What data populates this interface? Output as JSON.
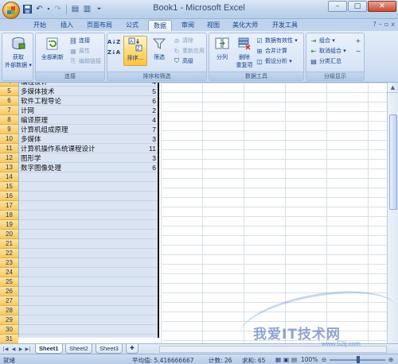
{
  "window": {
    "title": "Book1 - Microsoft Excel",
    "min": "–",
    "max": "□",
    "close": "✕"
  },
  "tabs": [
    "开始",
    "插入",
    "页面布局",
    "公式",
    "数据",
    "审阅",
    "视图",
    "美化大师",
    "开发工具"
  ],
  "active_tab": "数据",
  "tab_right": {
    "help": "?",
    "min": "–",
    "restore": "▫",
    "close": "x"
  },
  "ribbon": {
    "get_external": {
      "l1": "获取",
      "l2": "外部数据 ▾"
    },
    "connections": {
      "refresh_all": "全部刷新",
      "connect": "连接",
      "properties": "属性",
      "edit_links": "编辑链接",
      "group_label": "连接"
    },
    "sort_filter": {
      "sort": "排序...",
      "filter": "筛选",
      "clear": "清除",
      "reapply": "重新应用",
      "advanced": "高级",
      "group_label": "排序和筛选"
    },
    "data_tools": {
      "split": "分列",
      "remove_dup_1": "删除",
      "remove_dup_2": "重复项",
      "validation": "数据有效性 ▾",
      "consolidate": "合并计算",
      "what_if": "假设分析 ▾",
      "group_label": "数据工具"
    },
    "outline": {
      "group": "组合 ▾",
      "ungroup": "取消组合 ▾",
      "subtotal": "分类汇总",
      "group_label": "分级显示"
    }
  },
  "rows": [
    {
      "n": "4",
      "text": "编程设计",
      "value": "4"
    },
    {
      "n": "5",
      "text": "多媒体技术",
      "value": "5"
    },
    {
      "n": "6",
      "text": "软件工程导论",
      "value": "6"
    },
    {
      "n": "7",
      "text": "计网",
      "value": "2"
    },
    {
      "n": "8",
      "text": "编译原理",
      "value": "4"
    },
    {
      "n": "9",
      "text": "计算机组成原理",
      "value": "7"
    },
    {
      "n": "10",
      "text": "多媒体",
      "value": "3"
    },
    {
      "n": "11",
      "text": "计算机操作系统课程设计",
      "value": "11"
    },
    {
      "n": "12",
      "text": "图形学",
      "value": "3"
    },
    {
      "n": "13",
      "text": "数字图像处理",
      "value": "6"
    },
    {
      "n": "14",
      "text": "",
      "value": ""
    },
    {
      "n": "15",
      "text": "",
      "value": ""
    },
    {
      "n": "16",
      "text": "",
      "value": ""
    },
    {
      "n": "17",
      "text": "",
      "value": ""
    },
    {
      "n": "18",
      "text": "",
      "value": ""
    },
    {
      "n": "19",
      "text": "",
      "value": ""
    },
    {
      "n": "20",
      "text": "",
      "value": ""
    },
    {
      "n": "21",
      "text": "",
      "value": ""
    },
    {
      "n": "22",
      "text": "",
      "value": ""
    },
    {
      "n": "23",
      "text": "",
      "value": ""
    },
    {
      "n": "24",
      "text": "",
      "value": ""
    },
    {
      "n": "25",
      "text": "",
      "value": ""
    },
    {
      "n": "26",
      "text": "",
      "value": ""
    },
    {
      "n": "27",
      "text": "",
      "value": ""
    },
    {
      "n": "28",
      "text": "",
      "value": ""
    },
    {
      "n": "29",
      "text": "",
      "value": ""
    },
    {
      "n": "30",
      "text": "",
      "value": ""
    },
    {
      "n": "31",
      "text": "",
      "value": ""
    },
    {
      "n": "32",
      "text": "",
      "value": ""
    }
  ],
  "sheets": [
    "Sheet1",
    "Sheet2",
    "Sheet3"
  ],
  "active_sheet": "Sheet1",
  "status": {
    "mode": "就绪",
    "average": "平均值: 5.416666667",
    "count": "计数: 26",
    "sum": "求和: 65",
    "zoom": "100%"
  },
  "watermark": {
    "text": "我爱IT技术网",
    "url": "www.52ij.com"
  },
  "colors": {
    "selection_fill": "#dbe4f3",
    "header_highlight": "#f7c95a",
    "ribbon": "#d1e0f4"
  }
}
